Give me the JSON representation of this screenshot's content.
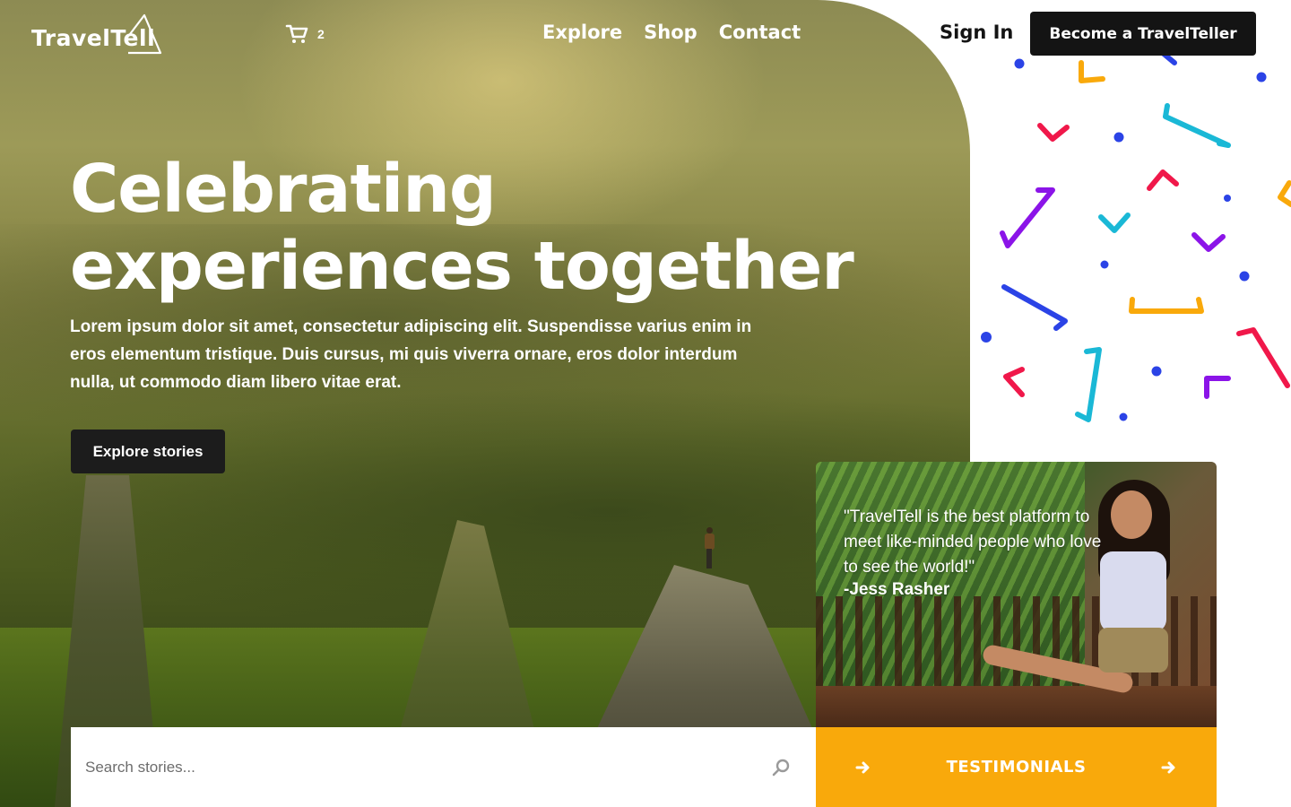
{
  "brand": {
    "logo_text": "TravelTell"
  },
  "cart": {
    "count": "2"
  },
  "nav": {
    "items": [
      {
        "label": "Explore"
      },
      {
        "label": "Shop"
      },
      {
        "label": "Contact"
      }
    ]
  },
  "auth": {
    "sign_in": "Sign In",
    "become": "Become a TravelTeller"
  },
  "hero": {
    "headline_line1": "Celebrating",
    "headline_line2": "experiences together",
    "subtext": "Lorem ipsum dolor sit amet, consectetur adipiscing elit. Suspendisse varius enim in eros elementum tristique. Duis cursus, mi quis viverra ornare, eros dolor interdum nulla, ut commodo diam libero vitae erat.",
    "cta": "Explore stories"
  },
  "search": {
    "placeholder": "Search stories..."
  },
  "testimonial": {
    "quote": "\"TravelTell is the best platform to meet like-minded people who love to see the world!\"",
    "author": "-Jess Rasher",
    "bar_label": "TESTIMONIALS"
  },
  "colors": {
    "accent": "#f9a90b",
    "dark": "#141414",
    "confetti_blue": "#2b43e6",
    "confetti_pink": "#f0184a",
    "confetti_teal": "#1ab8d6",
    "confetti_purple": "#8b14e8",
    "confetti_orange": "#f9a90b"
  },
  "icons": {
    "cart": "cart-icon",
    "search": "search-icon",
    "arrow": "arrow-right-icon",
    "logo_mark": "triangle-logo-icon"
  }
}
